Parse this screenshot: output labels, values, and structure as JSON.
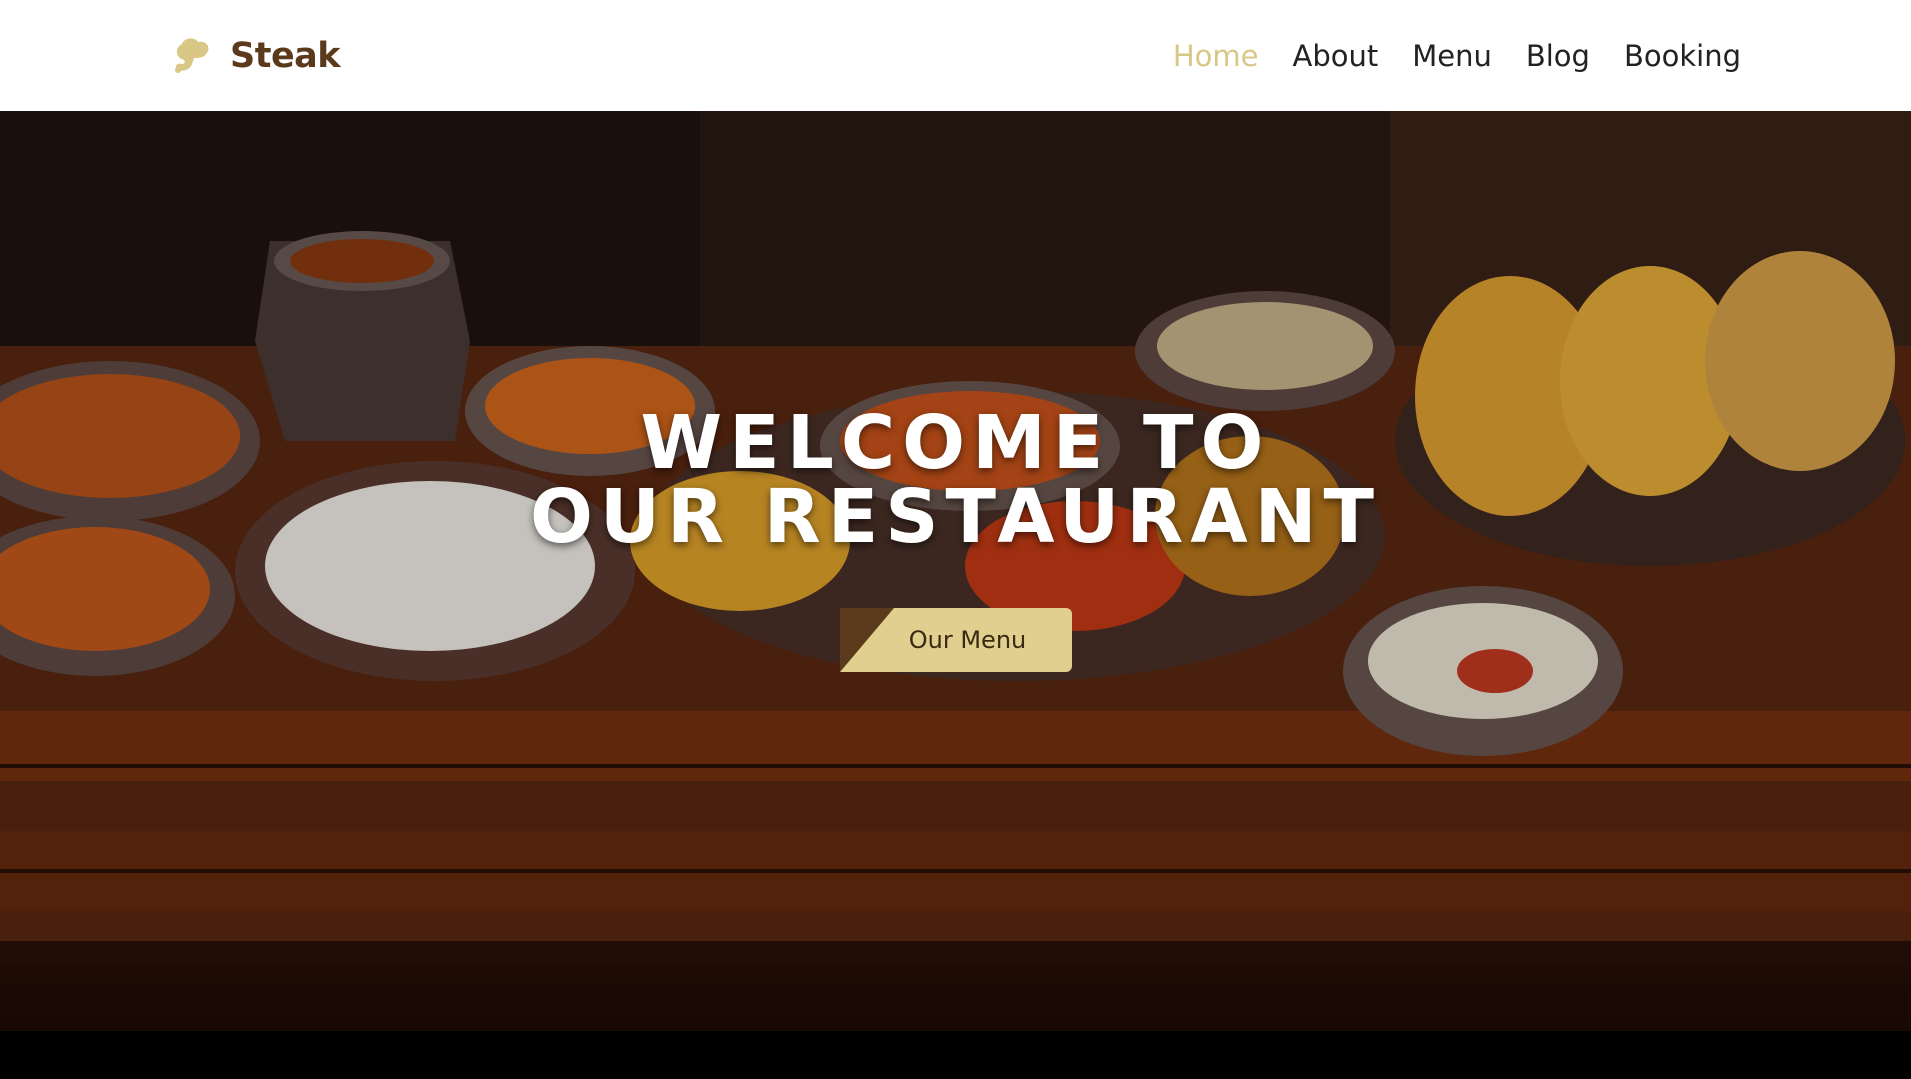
{
  "brand": {
    "name": "Steak",
    "icon": "chef-hat-logo-icon",
    "color": "#5a3a1a",
    "icon_color": "#d9c785"
  },
  "nav": {
    "items": [
      {
        "label": "Home",
        "active": true
      },
      {
        "label": "About",
        "active": false
      },
      {
        "label": "Menu",
        "active": false
      },
      {
        "label": "Blog",
        "active": false
      },
      {
        "label": "Booking",
        "active": false
      }
    ],
    "active_color": "#d9c785",
    "text_color": "#222222"
  },
  "hero": {
    "title_line1": "WELCOME TO",
    "title_line2": "OUR RESTAURANT",
    "cta_label": "Our Menu",
    "cta_color": "#e0cf8e",
    "background": "illustration-of-indian-dishes-on-wooden-table"
  }
}
